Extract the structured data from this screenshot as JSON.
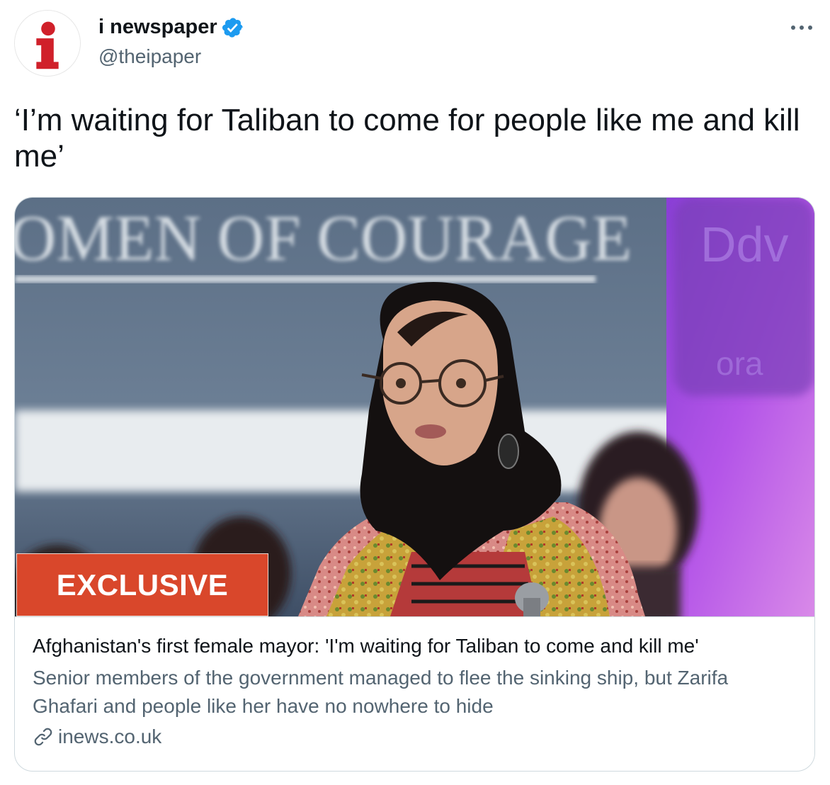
{
  "author": {
    "display_name": "i newspaper",
    "handle": "@theipaper",
    "avatar_letter": "i",
    "verified": true
  },
  "tweet": {
    "text": "‘I’m waiting for Taliban to come for people like me and kill me’"
  },
  "card": {
    "image_text": "OMEN OF COURAGE",
    "badge": "EXCLUSIVE",
    "title": "Afghanistan's first female mayor: 'I'm waiting for Taliban to come and kill me'",
    "description": "Senior members of the government managed to flee the sinking ship, but Zarifa Ghafari and people like her have no nowhere to hide",
    "domain": "inews.co.uk"
  },
  "icons": {
    "more": "more-icon",
    "verified": "verified-badge-icon",
    "link": "link-icon"
  },
  "colors": {
    "text_primary": "#0f1419",
    "text_secondary": "#536471",
    "verified_blue": "#1d9bf0",
    "brand_red": "#d0202a",
    "badge_orange": "#d9472b",
    "card_border": "#cfd9de"
  }
}
